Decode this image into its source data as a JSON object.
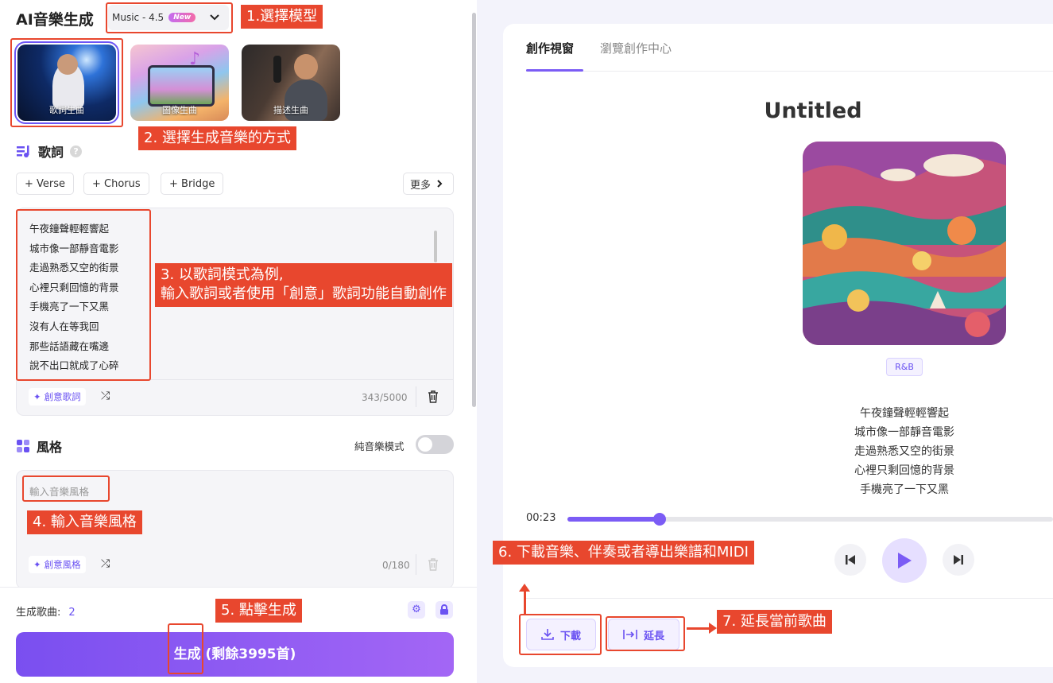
{
  "app": {
    "title": "AI音樂生成"
  },
  "model": {
    "name": "Music - 4.5",
    "badge": "New"
  },
  "modes": [
    {
      "label": "歌詞生曲"
    },
    {
      "label": "圖像生曲"
    },
    {
      "label": "描述生曲"
    }
  ],
  "lyrics_section": {
    "title": "歌詞",
    "help": "?",
    "chips": [
      "+ Verse",
      "+ Chorus",
      "+ Bridge"
    ],
    "more": "更多",
    "lines": [
      "午夜鐘聲輕輕響起",
      "城市像一部靜音電影",
      "走過熟悉又空的街景",
      "心裡只剩回憶的背景",
      "手機亮了一下又黑",
      "沒有人在等我回",
      "那些話語藏在嘴邊",
      "說不出口就成了心碎"
    ],
    "creative_label": "創意歌詞",
    "counter": "343/5000"
  },
  "style_section": {
    "title": "風格",
    "instrumental_label": "純音樂模式",
    "placeholder": "輸入音樂風格",
    "creative_label": "創意風格",
    "counter": "0/180"
  },
  "generate": {
    "count_label": "生成歌曲:",
    "count_value": "2",
    "button_label": "生成 (剩餘3995首)"
  },
  "preview": {
    "tabs": [
      "創作視窗",
      "瀏覽創作中心"
    ],
    "song_title": "Untitled",
    "genre": "R&B",
    "lyric_lines": [
      "午夜鐘聲輕輕響起",
      "城市像一部靜音電影",
      "走過熟悉又空的街景",
      "心裡只剩回憶的背景",
      "手機亮了一下又黑"
    ],
    "time": "00:23",
    "progress": 0.19,
    "download_label": "下載",
    "extend_label": "延長"
  },
  "annotations": {
    "a1": "1.選擇模型",
    "a2": "2. 選擇生成音樂的方式",
    "a3_line1": "3. 以歌詞模式為例,",
    "a3_line2": "輸入歌詞或者使用「創意」歌詞功能自動創作",
    "a4": "4. 輸入音樂風格",
    "a5": "5. 點擊生成",
    "a6": "6. 下載音樂、伴奏或者導出樂譜和MIDI",
    "a7": "7. 延長當前歌曲"
  },
  "colors": {
    "accent": "#7b5cf5",
    "annotation": "#e8472e"
  }
}
